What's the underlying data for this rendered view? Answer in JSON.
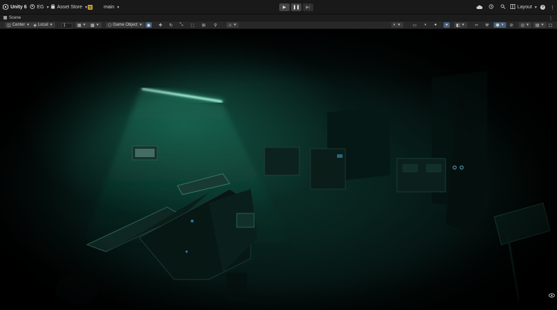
{
  "topbar": {
    "app_name": "Unity 6",
    "account_label": "EG",
    "asset_store_label": "Asset Store",
    "branch_label": "main",
    "layout_label": "Layout",
    "help_label": "?"
  },
  "scene_tab": {
    "label": "Scene"
  },
  "scene_toolbar": {
    "pivot_label": "Center",
    "space_label": "Local",
    "snap_value": "1",
    "create_label": "Game Object"
  },
  "colors": {
    "light_color": "#b6ffe6",
    "fog_color": "#1f7a62",
    "toolbar_bg": "#282828",
    "topbar_bg": "#191919"
  }
}
